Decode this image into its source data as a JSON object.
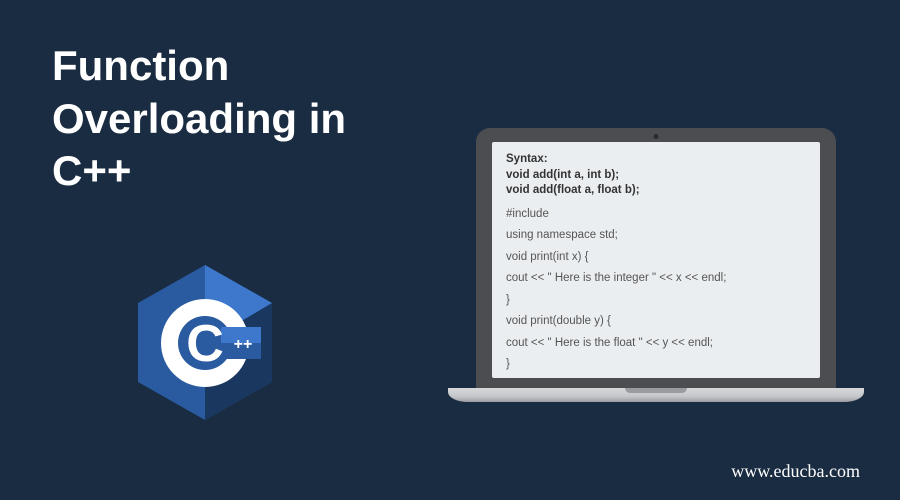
{
  "title": {
    "line1": "Function",
    "line2": "Overloading in",
    "line3": "C++"
  },
  "logo": {
    "letter": "C",
    "plus": "++",
    "colors": {
      "dark": "#1a3760",
      "mid": "#2a5aa0",
      "light": "#3d78cc",
      "inner": "#ffffff"
    }
  },
  "code": {
    "syntax_label": "Syntax:",
    "syntax_line1": "void add(int a, int b);",
    "syntax_line2": "void add(float a, float b);",
    "lines": [
      "#include",
      "using namespace std;",
      "void print(int x) {",
      "cout << \" Here is the integer \" << x << endl;",
      "}",
      "void print(double  y) {",
      "cout << \" Here is the float \" << y << endl;",
      "}"
    ]
  },
  "footer": {
    "url": "www.educba.com"
  }
}
